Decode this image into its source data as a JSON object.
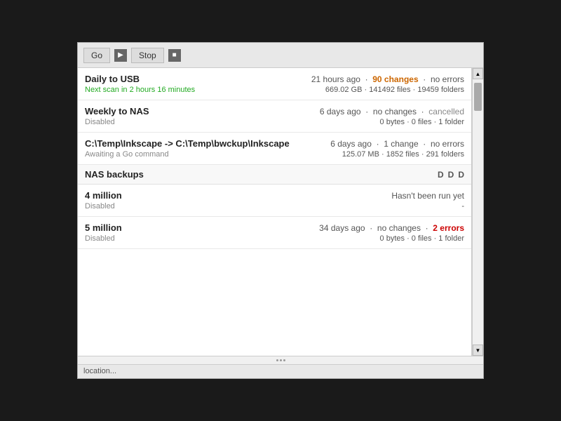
{
  "toolbar": {
    "go_label": "Go",
    "stop_label": "Stop"
  },
  "backups": [
    {
      "id": "daily-usb",
      "name": "Daily to USB",
      "status_time": "21 hours ago",
      "status_changes": "90 changes",
      "status_errors": "no errors",
      "sub_left": "Next scan in 2 hours 16 minutes",
      "sub_right": "669.02 GB · 141492 files · 19459 folders",
      "sub_left_class": "green",
      "changes_class": "orange",
      "errors_class": "normal"
    },
    {
      "id": "weekly-nas",
      "name": "Weekly to NAS",
      "status_time": "6 days ago",
      "status_changes": "no changes",
      "status_errors": "cancelled",
      "sub_left": "Disabled",
      "sub_right": "0 bytes · 0 files · 1 folder",
      "sub_left_class": "grey",
      "changes_class": "normal",
      "errors_class": "grey"
    },
    {
      "id": "inkscape-bwckup",
      "name": "C:\\Temp\\Inkscape -> C:\\Temp\\bwckup\\Inkscape",
      "status_time": "6 days ago",
      "status_changes": "1 change",
      "status_errors": "no errors",
      "sub_left": "Awaiting a Go command",
      "sub_right": "125.07 MB · 1852 files · 291 folders",
      "sub_left_class": "grey",
      "changes_class": "normal",
      "errors_class": "normal"
    }
  ],
  "section": {
    "name": "NAS backups",
    "actions": [
      "D",
      "D",
      "D"
    ]
  },
  "nas_backups": [
    {
      "id": "4million",
      "name": "4 million",
      "status_time": "Hasn't been run yet",
      "status_changes": "",
      "status_errors": "",
      "sub_left": "Disabled",
      "sub_right": "-",
      "sub_left_class": "grey",
      "changes_class": "normal",
      "errors_class": "normal"
    },
    {
      "id": "5million",
      "name": "5 million",
      "status_time": "34 days ago",
      "status_changes": "no changes",
      "status_errors": "2 errors",
      "sub_left": "Disabled",
      "sub_right": "0 bytes · 0 files · 1 folder",
      "sub_left_class": "grey",
      "changes_class": "normal",
      "errors_class": "red"
    }
  ],
  "bottom_bar": {
    "text": "location..."
  }
}
